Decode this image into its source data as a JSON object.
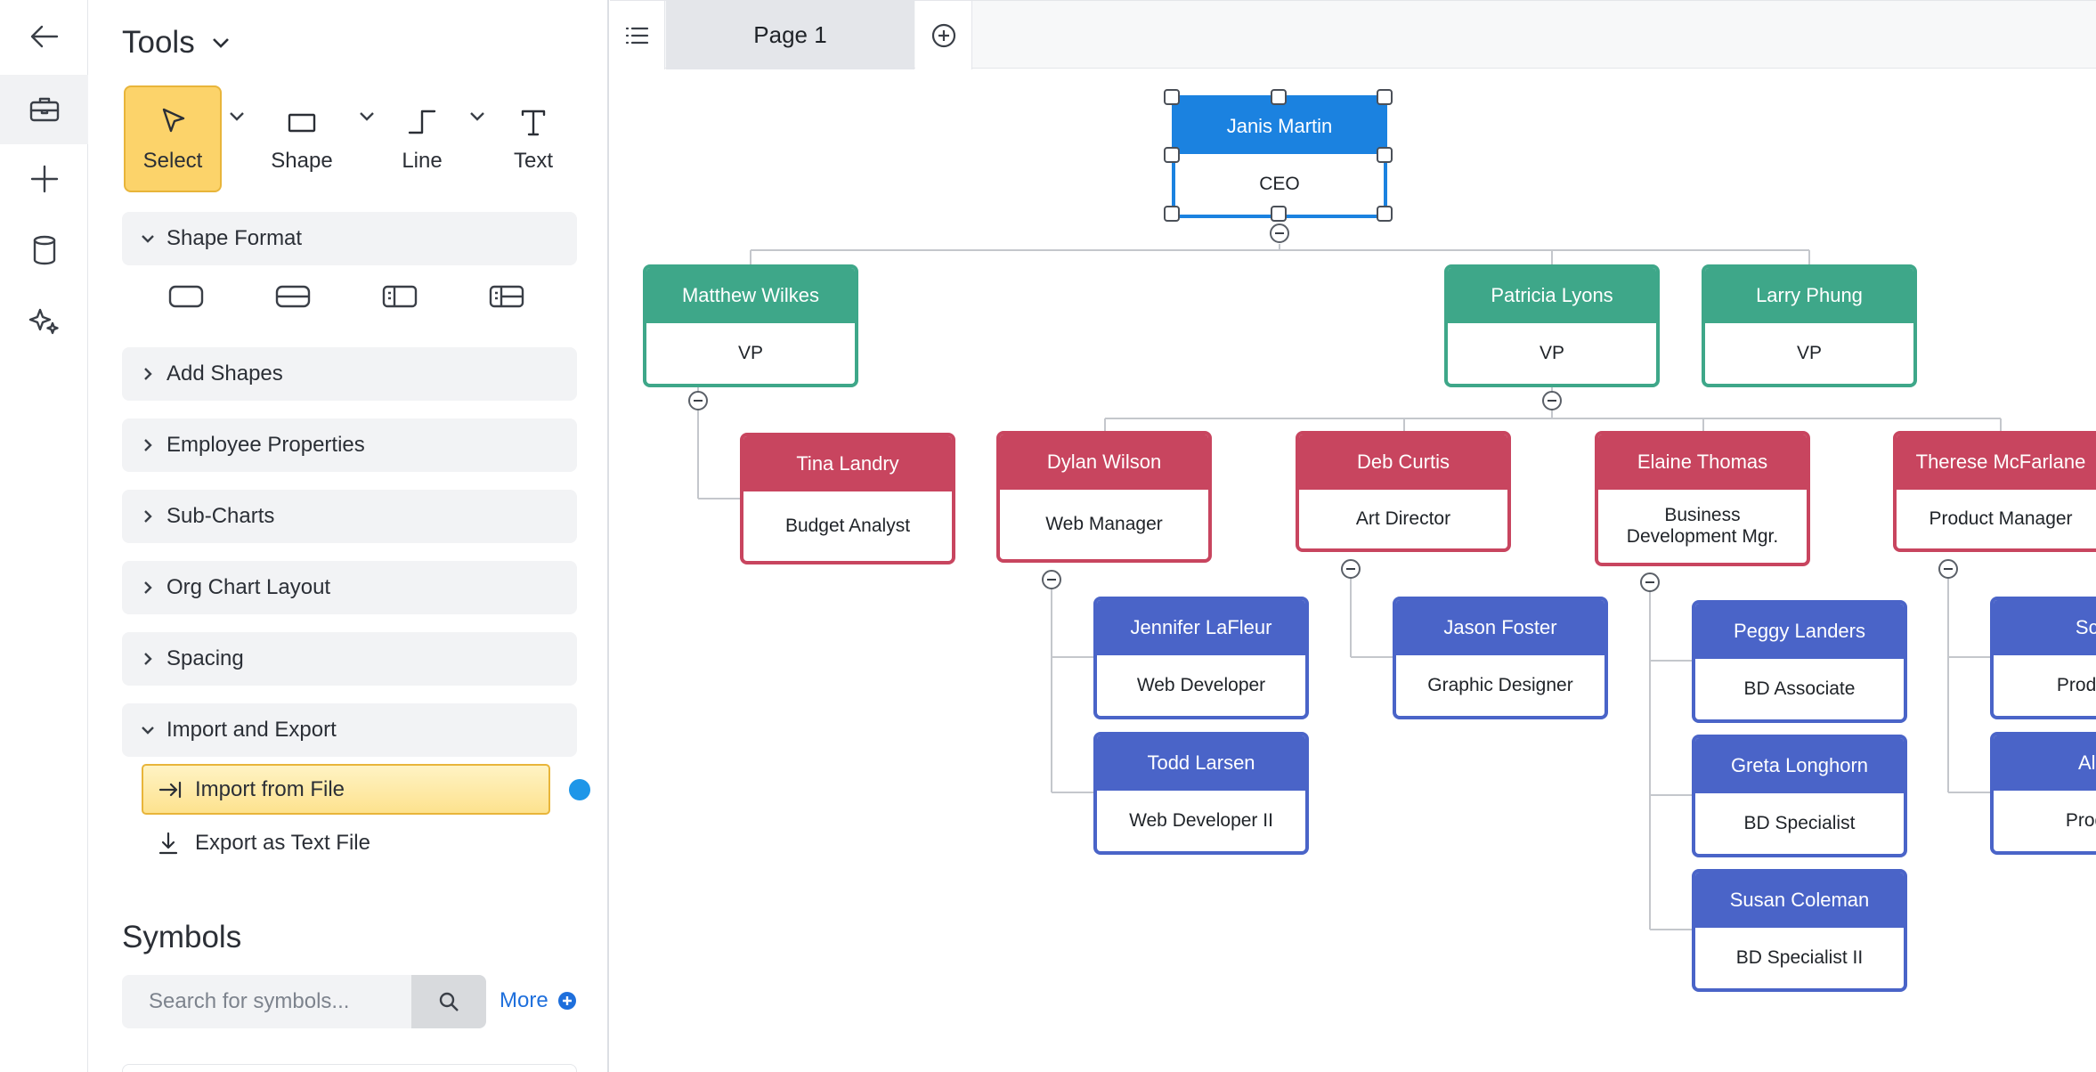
{
  "tools_panel": {
    "title": "Tools",
    "tools": [
      {
        "id": "select",
        "label": "Select",
        "selected": true
      },
      {
        "id": "shape",
        "label": "Shape"
      },
      {
        "id": "line",
        "label": "Line"
      },
      {
        "id": "text",
        "label": "Text"
      }
    ],
    "sections": {
      "shape_format": "Shape Format",
      "add_shapes": "Add Shapes",
      "employee_properties": "Employee Properties",
      "sub_charts": "Sub-Charts",
      "org_chart_layout": "Org Chart Layout",
      "spacing": "Spacing",
      "import_export": "Import and Export"
    },
    "import_export_items": {
      "import_file": "Import from File",
      "export_text": "Export as Text File"
    },
    "symbols": {
      "title": "Symbols",
      "search_placeholder": "Search for symbols...",
      "more_label": "More"
    }
  },
  "pages": {
    "current": "Page 1"
  },
  "colors": {
    "ceo": "#1b82e0",
    "vp": "#3ea789",
    "manager": "#c8455f",
    "staff": "#4a64c8",
    "highlight": "#fcd36a",
    "link": "#1e6fdc"
  },
  "org_chart": {
    "ceo": {
      "name": "Janis Martin",
      "title": "CEO"
    },
    "vps": [
      {
        "name": "Matthew Wilkes",
        "title": "VP"
      },
      {
        "name": "Patricia Lyons",
        "title": "VP"
      },
      {
        "name": "Larry Phung",
        "title": "VP"
      }
    ],
    "managers": [
      {
        "name": "Tina Landry",
        "title": "Budget Analyst"
      },
      {
        "name": "Dylan Wilson",
        "title": "Web Manager"
      },
      {
        "name": "Deb Curtis",
        "title": "Art Director"
      },
      {
        "name": "Elaine Thomas",
        "title": "Business\nDevelopment Mgr."
      },
      {
        "name": "Therese McFarlane",
        "title": "Product Manager"
      }
    ],
    "staff": [
      {
        "name": "Jennifer LaFleur",
        "title": "Web Developer"
      },
      {
        "name": "Todd Larsen",
        "title": "Web Developer II"
      },
      {
        "name": "Jason Foster",
        "title": "Graphic Designer"
      },
      {
        "name": "Peggy Landers",
        "title": "BD Associate"
      },
      {
        "name": "Greta Longhorn",
        "title": "BD Specialist"
      },
      {
        "name": "Susan Coleman",
        "title": "BD Specialist II"
      },
      {
        "name": "Scott",
        "title": "Product S"
      },
      {
        "name": "Alan",
        "title": "Product"
      }
    ]
  }
}
